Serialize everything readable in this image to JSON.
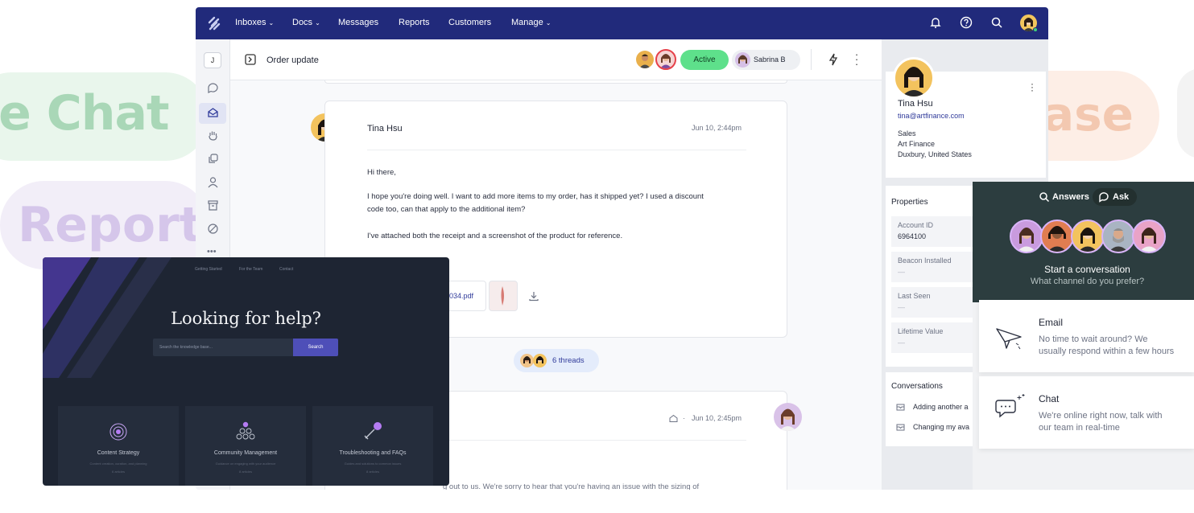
{
  "background": {
    "live_chat": "ve Chat",
    "reports": "Report",
    "knowledge_base": "ase"
  },
  "nav": {
    "items": [
      "Inboxes",
      "Docs",
      "Messages",
      "Reports",
      "Customers",
      "Manage"
    ],
    "accent": "#212a7b"
  },
  "rail": {
    "initial": "J"
  },
  "conversation": {
    "title": "Order update",
    "status": "Active",
    "assignee": "Sabrina B",
    "message1": {
      "author": "Tina Hsu",
      "time": "Jun 10, 2:44pm",
      "greeting": "Hi there,",
      "body_line1": "I hope you're doing well. I want to add more items to my order, has it shipped yet? I used a discount",
      "body_line2": "code too, can that apply to the additional item?",
      "body_line3": "I've attached both the receipt and a screenshot of the product for reference.",
      "attachment": "034.pdf"
    },
    "threads_label": "6 threads",
    "message2": {
      "time": "Jun 10, 2:45pm",
      "partial": "g out to us. We're sorry to hear that you're having an issue with the sizing of"
    }
  },
  "customer": {
    "name": "Tina Hsu",
    "email": "tina@artfinance.com",
    "dept": "Sales",
    "company": "Art Finance",
    "location": "Duxbury, United States"
  },
  "properties": {
    "heading": "Properties",
    "items": [
      {
        "label": "Account ID",
        "value": "6964100"
      },
      {
        "label": "Beacon Installed",
        "value": "—"
      },
      {
        "label": "Last Seen",
        "value": "—"
      },
      {
        "label": "Lifetime Value",
        "value": "—"
      }
    ]
  },
  "conversations": {
    "heading": "Conversations",
    "items": [
      "Adding another a",
      "Changing my ava"
    ]
  },
  "helpcenter": {
    "nav": [
      "Getting Started",
      "For the Team",
      "Contact"
    ],
    "title": "Looking for help?",
    "search_placeholder": "Search the knowledge base...",
    "search_button": "Search",
    "tiles": [
      {
        "title": "Content Strategy",
        "desc": "Content creation, curation, and planning",
        "count": "6 articles"
      },
      {
        "title": "Community Management",
        "desc": "Guidance on engaging with your audience",
        "count": "8 articles"
      },
      {
        "title": "Troubleshooting and FAQs",
        "desc": "Guides and solutions to common issues",
        "count": "8 articles"
      }
    ]
  },
  "beacon": {
    "answers": "Answers",
    "ask": "Ask",
    "start": "Start a conversation",
    "question": "What channel do you prefer?",
    "email_title": "Email",
    "email_desc1": "No time to wait around? We",
    "email_desc2": "usually respond within a few hours",
    "chat_title": "Chat",
    "chat_desc1": "We're online right now, talk with",
    "chat_desc2": "our team in real-time"
  }
}
